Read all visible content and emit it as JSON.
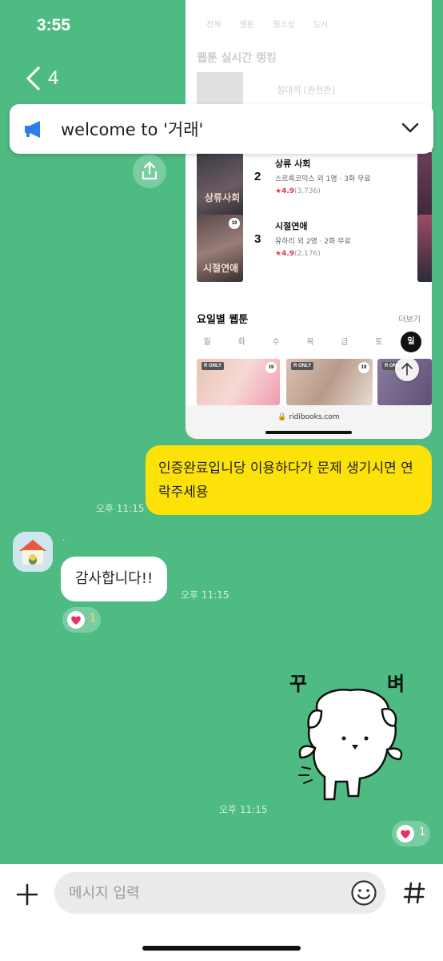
{
  "status_bar": {
    "time": "3:55"
  },
  "header": {
    "member_count": "4"
  },
  "notice": {
    "text": "welcome to '거래'"
  },
  "shared_image": {
    "faded_header": {
      "tabs": [
        "전체",
        "웹툰",
        "웹소설",
        "도서"
      ],
      "title": "웹툰 실시간 랭킹",
      "first_item": "절대적 [완전판]"
    },
    "rankings": [
      {
        "rank": "2",
        "title": "상류 사회",
        "meta": "스르륵코믹스 외 1명 · 3화 무료",
        "rating": "4.9",
        "count": "(3,736)",
        "thumb_text": "상류사회"
      },
      {
        "rank": "3",
        "title": "시절연애",
        "meta": "유하리 외 2명 · 2화 무료",
        "rating": "4.9",
        "count": "(2,176)",
        "thumb_text": "시절연애",
        "badge": "19"
      }
    ],
    "day_section": {
      "title": "요일별 웹툰",
      "more": "더보기",
      "days": [
        "월",
        "화",
        "수",
        "목",
        "금",
        "토",
        "일"
      ],
      "active_day": "일"
    },
    "day_thumbs": [
      {
        "tag": "R ONLY",
        "badge": "19"
      },
      {
        "tag": "R ONLY",
        "badge": "19"
      },
      {
        "tag": "R ONLY"
      }
    ],
    "url": "ridibooks.com"
  },
  "messages": [
    {
      "type": "sent",
      "text": "인증완료입니당 이용하다가 문제 생기시면 연락주세용",
      "time": "오후 11:15"
    },
    {
      "type": "received",
      "sender": "·",
      "text": "감사합니다!!",
      "time": "오후 11:15",
      "reaction_count": "1"
    },
    {
      "type": "sticker",
      "text_left": "꾸",
      "text_right": "벼",
      "time": "오후 11:15",
      "reaction_count": "1"
    }
  ],
  "input": {
    "placeholder": "메시지 입력"
  },
  "colors": {
    "chat_background": "#4ebb83",
    "my_bubble": "#fde20a",
    "heart": "#e6335d"
  }
}
